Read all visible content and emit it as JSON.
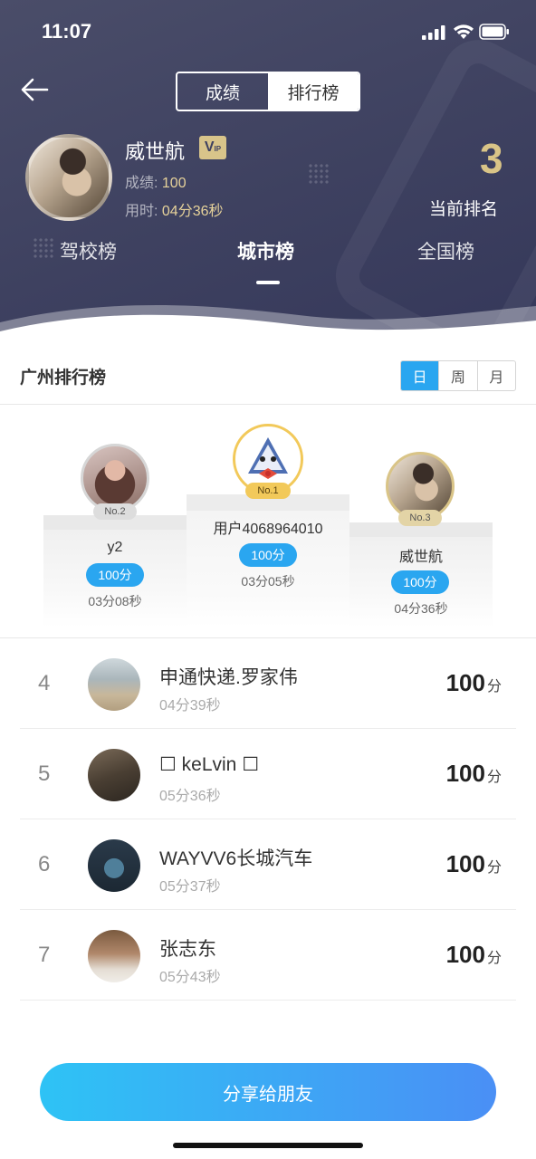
{
  "status": {
    "time": "11:07"
  },
  "header": {
    "segment": {
      "tab_score": "成绩",
      "tab_rank": "排行榜",
      "active": "排行榜"
    },
    "user": {
      "name": "威世航",
      "vip_label": "V",
      "score_label": "成绩:",
      "score_value": "100",
      "time_label": "用时:",
      "time_value": "04分36秒"
    },
    "current_rank": {
      "value": "3",
      "label": "当前排名"
    },
    "tabs": [
      {
        "label": "驾校榜"
      },
      {
        "label": "城市榜",
        "active": true
      },
      {
        "label": "全国榜"
      }
    ]
  },
  "section": {
    "title": "广州排行榜",
    "period_options": [
      "日",
      "周",
      "月"
    ],
    "period_selected": "日"
  },
  "podium": {
    "second": {
      "badge": "No.2",
      "name": "y2",
      "score": "100分",
      "time": "03分08秒"
    },
    "first": {
      "badge": "No.1",
      "name": "用户4068964010",
      "score": "100分",
      "time": "03分05秒"
    },
    "third": {
      "badge": "No.3",
      "name": "威世航",
      "score": "100分",
      "time": "04分36秒"
    }
  },
  "list": [
    {
      "rank": "4",
      "name": "申通快递.罗家伟",
      "time": "04分39秒",
      "score": "100",
      "unit": "分"
    },
    {
      "rank": "5",
      "name": "☐  keLvin ☐",
      "time": "05分36秒",
      "score": "100",
      "unit": "分"
    },
    {
      "rank": "6",
      "name": "WAYVV6长城汽车",
      "time": "05分37秒",
      "score": "100",
      "unit": "分"
    },
    {
      "rank": "7",
      "name": "张志东",
      "time": "05分43秒",
      "score": "100",
      "unit": "分"
    }
  ],
  "share_button": "分享给朋友",
  "colors": {
    "accent": "#2aa6f0",
    "header_bg": "#3e4160",
    "gold": "#d9c487"
  }
}
